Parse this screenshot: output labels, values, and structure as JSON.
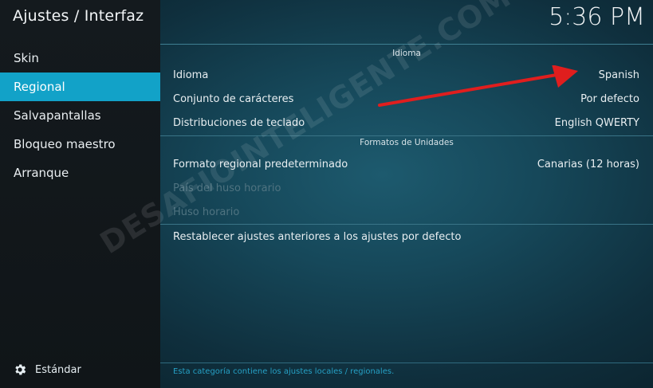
{
  "header": {
    "title": "Ajustes / Interfaz",
    "clock": "5:36 PM"
  },
  "sidebar": {
    "items": [
      {
        "label": "Skin"
      },
      {
        "label": "Regional"
      },
      {
        "label": "Salvapantallas"
      },
      {
        "label": "Bloqueo maestro"
      },
      {
        "label": "Arranque"
      }
    ],
    "preset_label": "Estándar"
  },
  "sections": {
    "idioma": {
      "header": "Idioma",
      "rows": [
        {
          "label": "Idioma",
          "value": "Spanish"
        },
        {
          "label": "Conjunto de carácteres",
          "value": "Por defecto"
        },
        {
          "label": "Distribuciones de teclado",
          "value": "English QWERTY"
        }
      ]
    },
    "formatos": {
      "header": "Formatos de Unidades",
      "rows": [
        {
          "label": "Formato regional predeterminado",
          "value": "Canarias (12 horas)"
        },
        {
          "label": "País del huso horario"
        },
        {
          "label": "Huso horario"
        }
      ]
    },
    "reset_label": "Restablecer ajustes anteriores a los ajustes por defecto"
  },
  "footer_text": "Esta categoría contiene los ajustes locales / regionales.",
  "watermark": "DESAFIOINTELIGENTE.COM",
  "colors": {
    "accent": "#12a2c8",
    "arrow": "#e01e1e"
  }
}
